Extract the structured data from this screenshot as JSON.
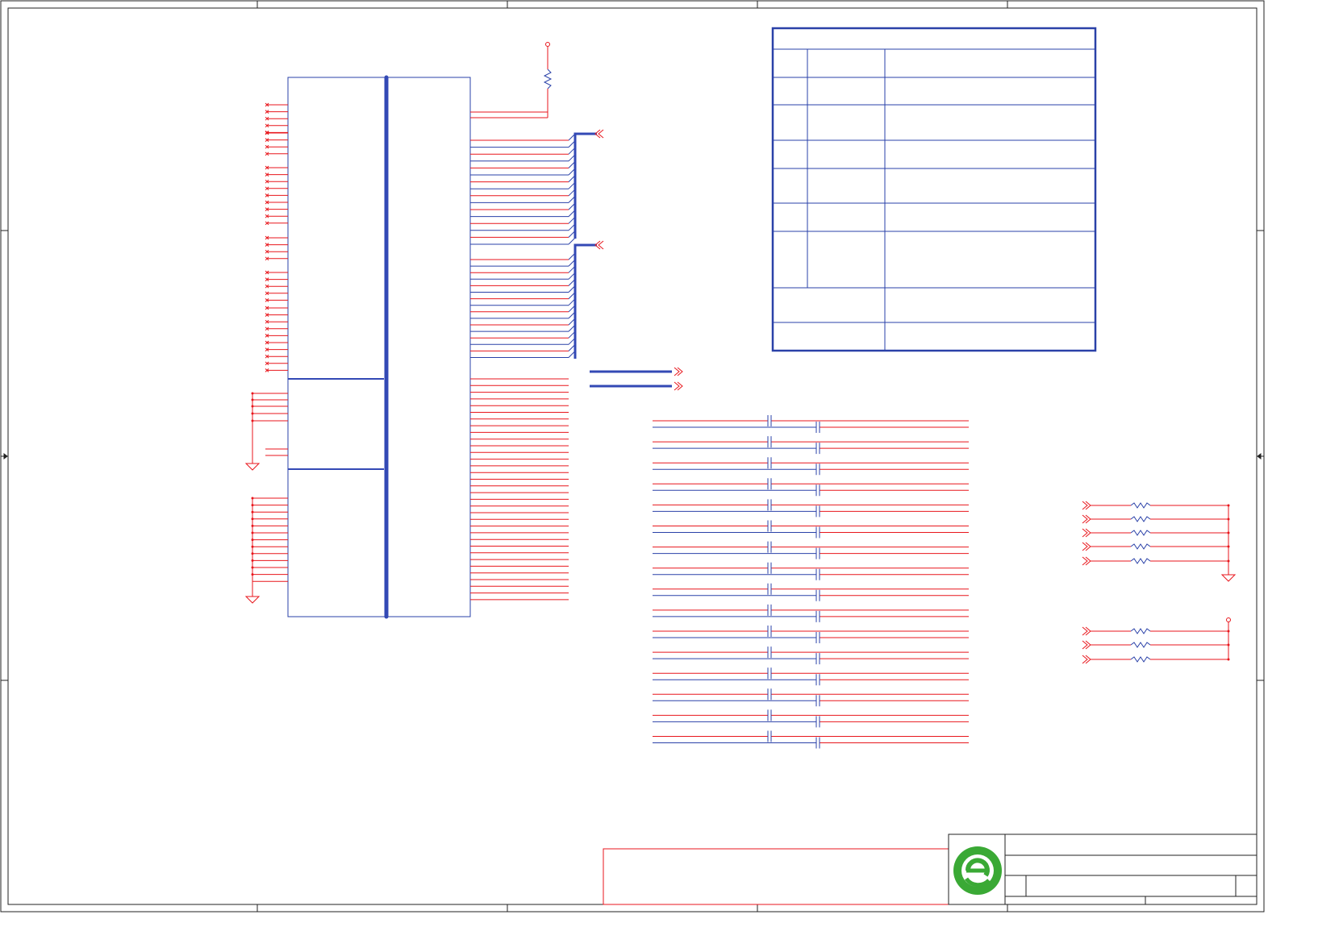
{
  "colors": {
    "wire": "#e8161c",
    "part": "#2a41a8",
    "bus": "#3349b5",
    "border": "#222222",
    "logo": "#3aa935"
  },
  "connector_block": {
    "left_pins": 44,
    "right_pins_upper": 32,
    "right_pins_lower": 34
  },
  "bus_arrows": 2,
  "offpage_arrows": 2,
  "capacitor_rows": 16,
  "resistor_groups": [
    {
      "count": 5,
      "terminal": "ground-icon"
    },
    {
      "count": 3,
      "terminal": "power-pin-icon"
    }
  ],
  "table": {
    "rows_with_left_col": 7,
    "rows_merged": 2
  },
  "title_block": {
    "logo": "company-logo-icon"
  }
}
